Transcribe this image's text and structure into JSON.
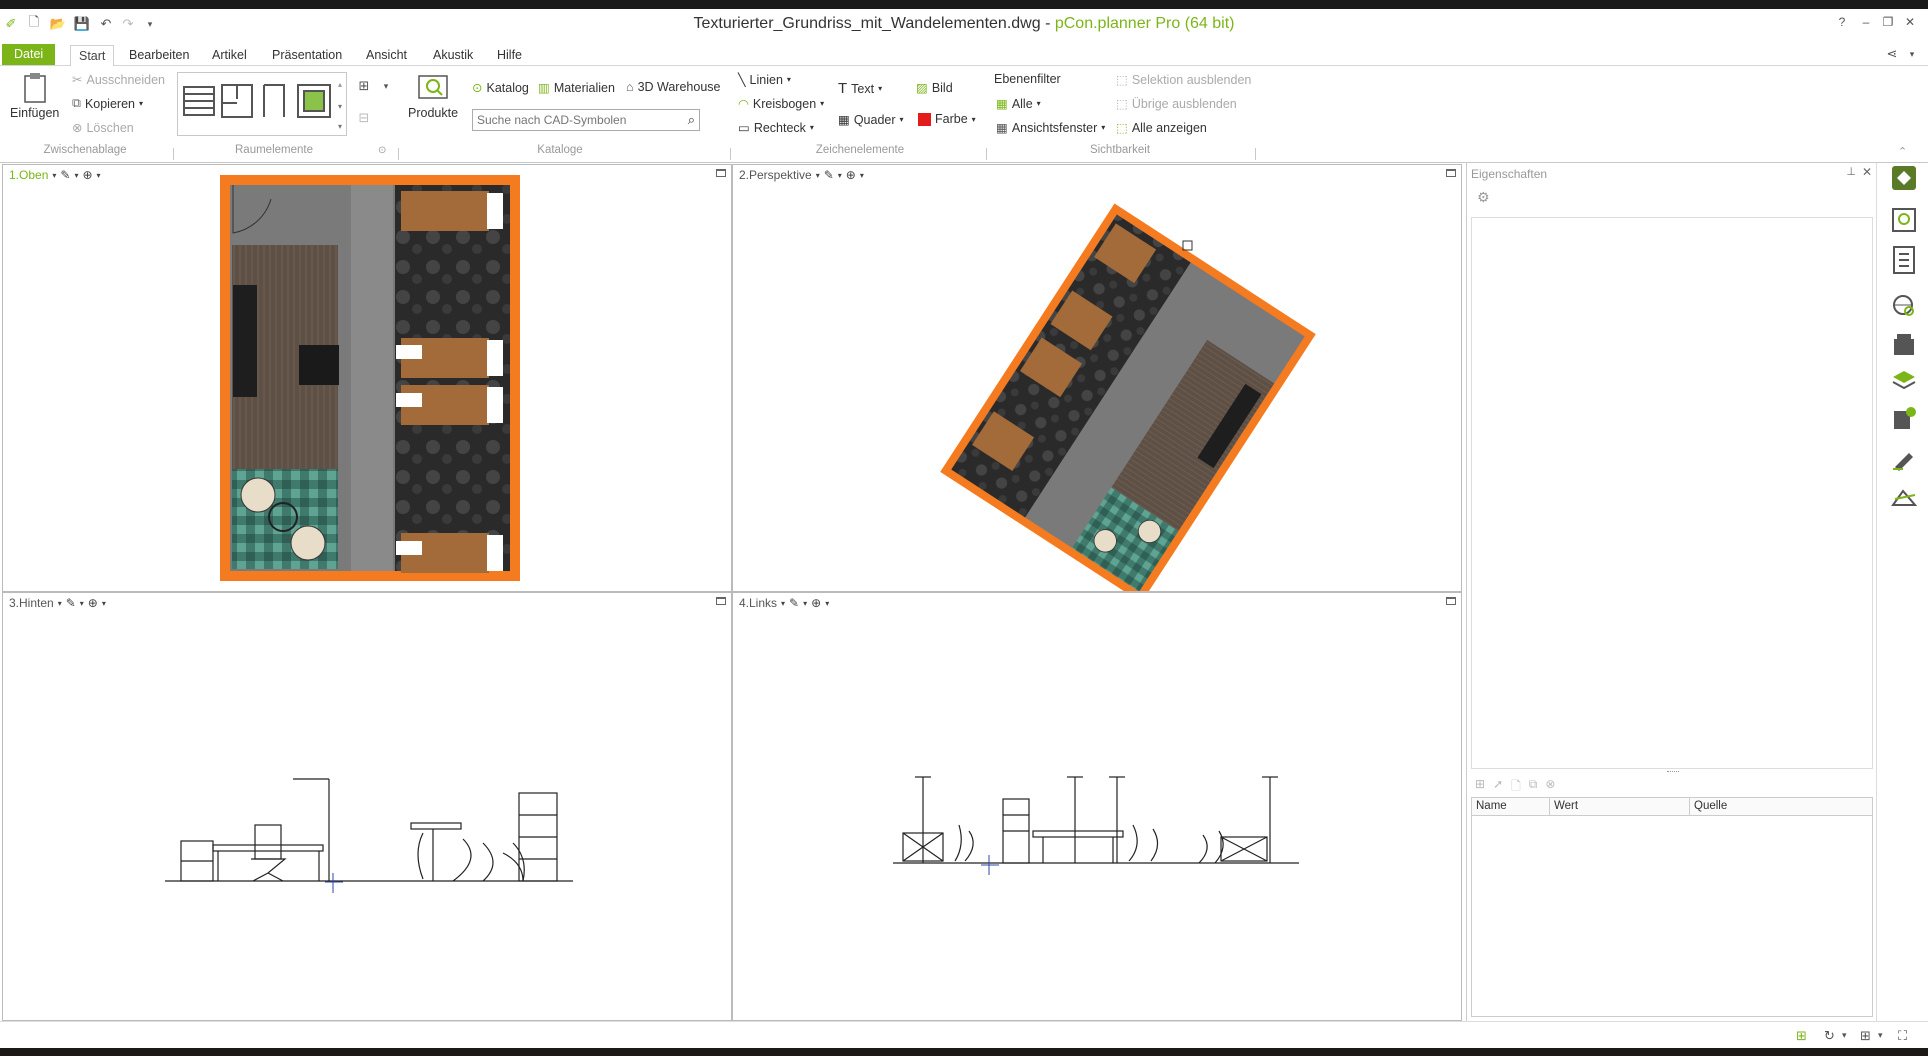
{
  "window": {
    "file_title": "Texturierter_Grundriss_mit_Wandelementen.dwg",
    "app_title": "pCon.planner Pro (64 bit)",
    "help": "?"
  },
  "tabs": [
    "Datei",
    "Start",
    "Bearbeiten",
    "Artikel",
    "Präsentation",
    "Ansicht",
    "Akustik",
    "Hilfe"
  ],
  "ribbon": {
    "clipboard": {
      "paste": "Einfügen",
      "cut": "Ausschneiden",
      "copy": "Kopieren",
      "delete": "Löschen",
      "group": "Zwischenablage"
    },
    "room": {
      "group": "Raumelemente"
    },
    "catalogs": {
      "products": "Produkte",
      "catalog": "Katalog",
      "materials": "Materialien",
      "warehouse": "3D Warehouse",
      "search_placeholder": "Suche nach CAD-Symbolen",
      "group": "Kataloge"
    },
    "drawing": {
      "lines": "Linien",
      "arc": "Kreisbogen",
      "rect": "Rechteck",
      "text": "Text",
      "box": "Quader",
      "image": "Bild",
      "color": "Farbe",
      "group": "Zeichenelemente"
    },
    "visibility": {
      "layer_filter": "Ebenenfilter",
      "all": "Alle",
      "view_window": "Ansichtsfenster",
      "hide_sel": "Selektion ausblenden",
      "hide_other": "Übrige ausblenden",
      "show_all": "Alle anzeigen",
      "group": "Sichtbarkeit"
    }
  },
  "views": [
    {
      "label": "1.Oben"
    },
    {
      "label": "2.Perspektive"
    },
    {
      "label": "3.Hinten"
    },
    {
      "label": "4.Links"
    }
  ],
  "properties": {
    "title": "Eigenschaften",
    "columns": [
      "Name",
      "Wert",
      "Quelle"
    ]
  },
  "colors": {
    "accent": "#7cb518",
    "wall": "#f47b20",
    "floor_wood": "#6b5a4a",
    "floor_tile": "#4d8a7c",
    "floor_dark": "#2c2c2c",
    "corridor": "#7a7a7a"
  }
}
